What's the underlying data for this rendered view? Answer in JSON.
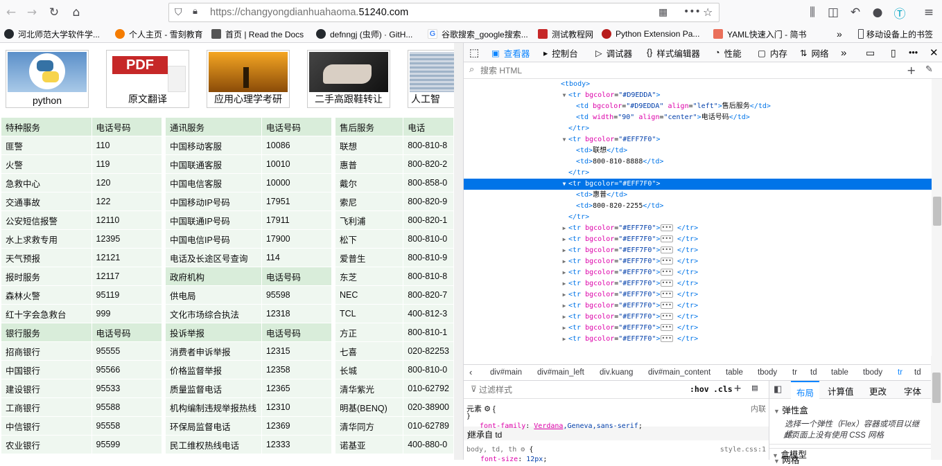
{
  "browser": {
    "url_prefix": "https://changyongdianhuahaoma.",
    "url_domain": "51240.com",
    "bookmarks": [
      "河北师范大学软件学...",
      "个人主页 - 雪刻教育",
      "首页 | Read the Docs",
      "defnngj (虫师) · GitH...",
      "谷歌搜索_google搜索...",
      "测试教程网",
      "Python Extension Pa...",
      "YAML快速入门 - 简书",
      "移动设备上的书签"
    ]
  },
  "page": {
    "thumbs": [
      "python",
      "原文翻译",
      "应用心理学考研",
      "二手高跟鞋转让",
      "人工智"
    ],
    "col1": [
      {
        "h": true,
        "a": "特种服务",
        "b": "电话号码"
      },
      {
        "a": "匪警",
        "b": "110"
      },
      {
        "a": "火警",
        "b": "119"
      },
      {
        "a": "急救中心",
        "b": "120"
      },
      {
        "a": "交通事故",
        "b": "122"
      },
      {
        "a": "公安短信报警",
        "b": "12110"
      },
      {
        "a": "水上求救专用",
        "b": "12395"
      },
      {
        "a": "天气预报",
        "b": "12121"
      },
      {
        "a": "报时服务",
        "b": "12117"
      },
      {
        "a": "森林火警",
        "b": "95119"
      },
      {
        "a": "红十字会急救台",
        "b": "999"
      },
      {
        "h": true,
        "a": "银行服务",
        "b": "电话号码"
      },
      {
        "a": "招商银行",
        "b": "95555"
      },
      {
        "a": "中国银行",
        "b": "95566"
      },
      {
        "a": "建设银行",
        "b": "95533"
      },
      {
        "a": "工商银行",
        "b": "95588"
      },
      {
        "a": "中信银行",
        "b": "95558"
      },
      {
        "a": "农业银行",
        "b": "95599"
      }
    ],
    "col2": [
      {
        "h": true,
        "a": "通讯服务",
        "b": "电话号码"
      },
      {
        "a": "中国移动客服",
        "b": "10086"
      },
      {
        "a": "中国联通客服",
        "b": "10010"
      },
      {
        "a": "中国电信客服",
        "b": "10000"
      },
      {
        "a": "中国移动IP号码",
        "b": "17951"
      },
      {
        "a": "中国联通IP号码",
        "b": "17911"
      },
      {
        "a": "中国电信IP号码",
        "b": "17900"
      },
      {
        "a": "电话及长途区号查询",
        "b": "114"
      },
      {
        "h": true,
        "a": "政府机构",
        "b": "电话号码"
      },
      {
        "a": "供电局",
        "b": "95598"
      },
      {
        "a": "文化市场综合执法",
        "b": "12318"
      },
      {
        "h": true,
        "a": "投诉举报",
        "b": "电话号码"
      },
      {
        "a": "消费者申诉举报",
        "b": "12315"
      },
      {
        "a": "价格监督举报",
        "b": "12358"
      },
      {
        "a": "质量监督电话",
        "b": "12365"
      },
      {
        "a": "机构编制违规举报热线",
        "b": "12310"
      },
      {
        "a": "环保局监督电话",
        "b": "12369"
      },
      {
        "a": "民工维权热线电话",
        "b": "12333"
      }
    ],
    "col3": [
      {
        "h": true,
        "a": "售后服务",
        "b": "电话"
      },
      {
        "a": "联想",
        "b": "800-810-8"
      },
      {
        "a": "惠普",
        "b": "800-820-2"
      },
      {
        "a": "戴尔",
        "b": "800-858-0"
      },
      {
        "a": "索尼",
        "b": "800-820-9"
      },
      {
        "a": "飞利浦",
        "b": "800-820-1"
      },
      {
        "a": "松下",
        "b": "800-810-0"
      },
      {
        "a": "爱普生",
        "b": "800-810-9"
      },
      {
        "a": "东芝",
        "b": "800-810-8"
      },
      {
        "a": "NEC",
        "b": "800-820-7"
      },
      {
        "a": "TCL",
        "b": "400-812-3"
      },
      {
        "a": "方正",
        "b": "800-810-1"
      },
      {
        "a": "七喜",
        "b": "020-82253"
      },
      {
        "a": "长城",
        "b": "800-810-0"
      },
      {
        "a": "清华紫光",
        "b": "010-62792"
      },
      {
        "a": "明基(BENQ)",
        "b": "020-38900"
      },
      {
        "a": "清华同方",
        "b": "010-62789"
      },
      {
        "a": "诺基亚",
        "b": "400-880-0"
      }
    ]
  },
  "devtools": {
    "tabs": [
      "查看器",
      "控制台",
      "调试器",
      "样式编辑器",
      "性能",
      "内存",
      "网络"
    ],
    "search_placeholder": "搜索 HTML",
    "markup": [
      {
        "i": 0,
        "tw": "",
        "html": "<span class='tag'>&lt;tbody&gt;</span>"
      },
      {
        "i": 1,
        "tw": "▼",
        "html": "<span class='tag'>&lt;tr</span> <span class='an'>bgcolor</span>=<span class='av'>\"#D9EDDA\"</span><span class='tag'>&gt;</span>"
      },
      {
        "i": 2,
        "tw": "",
        "html": "<span class='tag'>&lt;td</span> <span class='an'>bgcolor</span>=<span class='av'>\"#D9EDDA\"</span> <span class='an'>align</span>=<span class='av'>\"left\"</span><span class='tag'>&gt;</span><span class='tx'>售后服务</span><span class='tag'>&lt;/td&gt;</span>"
      },
      {
        "i": 2,
        "tw": "",
        "html": "<span class='tag'>&lt;td</span> <span class='an'>width</span>=<span class='av'>\"90\"</span> <span class='an'>align</span>=<span class='av'>\"center\"</span><span class='tag'>&gt;</span><span class='tx'>电话号码</span><span class='tag'>&lt;/td&gt;</span>"
      },
      {
        "i": 1,
        "tw": "",
        "html": "<span class='tag'>&lt;/tr&gt;</span>"
      },
      {
        "i": 1,
        "tw": "▼",
        "html": "<span class='tag'>&lt;tr</span> <span class='an'>bgcolor</span>=<span class='av'>\"#EFF7F0\"</span><span class='tag'>&gt;</span>"
      },
      {
        "i": 2,
        "tw": "",
        "html": "<span class='tag'>&lt;td&gt;</span><span class='tx'>联想</span><span class='tag'>&lt;/td&gt;</span>"
      },
      {
        "i": 2,
        "tw": "",
        "html": "<span class='tag'>&lt;td&gt;</span><span class='tx'>800-810-8888</span><span class='tag'>&lt;/td&gt;</span>"
      },
      {
        "i": 1,
        "tw": "",
        "html": "<span class='tag'>&lt;/tr&gt;</span>"
      },
      {
        "i": 1,
        "tw": "▼",
        "sel": true,
        "html": "<span class='tag'>&lt;tr</span> <span class='an'>bgcolor</span>=<span class='av'>\"#EFF7F0\"</span><span class='tag'>&gt;</span>"
      },
      {
        "i": 2,
        "tw": "",
        "html": "<span class='tag'>&lt;td&gt;</span><span class='tx'>惠普</span><span class='tag'>&lt;/td&gt;</span>"
      },
      {
        "i": 2,
        "tw": "",
        "html": "<span class='tag'>&lt;td&gt;</span><span class='tx'>800-820-2255</span><span class='tag'>&lt;/td&gt;</span>"
      },
      {
        "i": 1,
        "tw": "",
        "html": "<span class='tag'>&lt;/tr&gt;</span>"
      },
      {
        "i": 1,
        "tw": "▶",
        "html": "<span class='tag'>&lt;tr</span> <span class='an'>bgcolor</span>=<span class='av'>\"#EFF7F0\"</span><span class='tag'>&gt;</span><span class='dots'>•••</span> <span class='tag'>&lt;/tr&gt;</span>"
      },
      {
        "i": 1,
        "tw": "▶",
        "html": "<span class='tag'>&lt;tr</span> <span class='an'>bgcolor</span>=<span class='av'>\"#EFF7F0\"</span><span class='tag'>&gt;</span><span class='dots'>•••</span> <span class='tag'>&lt;/tr&gt;</span>"
      },
      {
        "i": 1,
        "tw": "▶",
        "html": "<span class='tag'>&lt;tr</span> <span class='an'>bgcolor</span>=<span class='av'>\"#EFF7F0\"</span><span class='tag'>&gt;</span><span class='dots'>•••</span> <span class='tag'>&lt;/tr&gt;</span>"
      },
      {
        "i": 1,
        "tw": "▶",
        "html": "<span class='tag'>&lt;tr</span> <span class='an'>bgcolor</span>=<span class='av'>\"#EFF7F0\"</span><span class='tag'>&gt;</span><span class='dots'>•••</span> <span class='tag'>&lt;/tr&gt;</span>"
      },
      {
        "i": 1,
        "tw": "▶",
        "html": "<span class='tag'>&lt;tr</span> <span class='an'>bgcolor</span>=<span class='av'>\"#EFF7F0\"</span><span class='tag'>&gt;</span><span class='dots'>•••</span> <span class='tag'>&lt;/tr&gt;</span>"
      },
      {
        "i": 1,
        "tw": "▶",
        "html": "<span class='tag'>&lt;tr</span> <span class='an'>bgcolor</span>=<span class='av'>\"#EFF7F0\"</span><span class='tag'>&gt;</span><span class='dots'>•••</span> <span class='tag'>&lt;/tr&gt;</span>"
      },
      {
        "i": 1,
        "tw": "▶",
        "html": "<span class='tag'>&lt;tr</span> <span class='an'>bgcolor</span>=<span class='av'>\"#EFF7F0\"</span><span class='tag'>&gt;</span><span class='dots'>•••</span> <span class='tag'>&lt;/tr&gt;</span>"
      },
      {
        "i": 1,
        "tw": "▶",
        "html": "<span class='tag'>&lt;tr</span> <span class='an'>bgcolor</span>=<span class='av'>\"#EFF7F0\"</span><span class='tag'>&gt;</span><span class='dots'>•••</span> <span class='tag'>&lt;/tr&gt;</span>"
      },
      {
        "i": 1,
        "tw": "▶",
        "html": "<span class='tag'>&lt;tr</span> <span class='an'>bgcolor</span>=<span class='av'>\"#EFF7F0\"</span><span class='tag'>&gt;</span><span class='dots'>•••</span> <span class='tag'>&lt;/tr&gt;</span>"
      },
      {
        "i": 1,
        "tw": "▶",
        "html": "<span class='tag'>&lt;tr</span> <span class='an'>bgcolor</span>=<span class='av'>\"#EFF7F0\"</span><span class='tag'>&gt;</span><span class='dots'>•••</span> <span class='tag'>&lt;/tr&gt;</span>"
      },
      {
        "i": 1,
        "tw": "▶",
        "html": "<span class='tag'>&lt;tr</span> <span class='an'>bgcolor</span>=<span class='av'>\"#EFF7F0\"</span><span class='tag'>&gt;</span><span class='dots'>•••</span> <span class='tag'>&lt;/tr&gt;</span>"
      }
    ],
    "breadcrumbs": [
      "div#main",
      "div#main_left",
      "div.kuang",
      "div#main_content",
      "table",
      "tbody",
      "tr",
      "td",
      "table",
      "tbody",
      "tr",
      "td"
    ],
    "filter_placeholder": "过滤样式",
    "hov": ":hov",
    "cls": ".cls",
    "side_tabs": [
      "布局",
      "计算值",
      "更改",
      "字体"
    ],
    "rules": {
      "element_label": "元素",
      "inline_label": "内联",
      "inherited_label": "继承自 td",
      "selector": "body, td, th",
      "source": "style.css:1",
      "prop1_name": "font-size",
      "prop1_value": "12px",
      "prop2_name": "font-family",
      "prop2_value_link": "Verdana",
      "prop2_value_rest": ",Geneva,sans-serif"
    },
    "layout": {
      "flex_title": "弹性盒",
      "flex_desc": "选择一个弹性（Flex）容器或项目以继续。",
      "grid_title": "网格",
      "grid_desc": "此页面上没有使用 CSS 网格",
      "box_title": "盒模型"
    }
  }
}
